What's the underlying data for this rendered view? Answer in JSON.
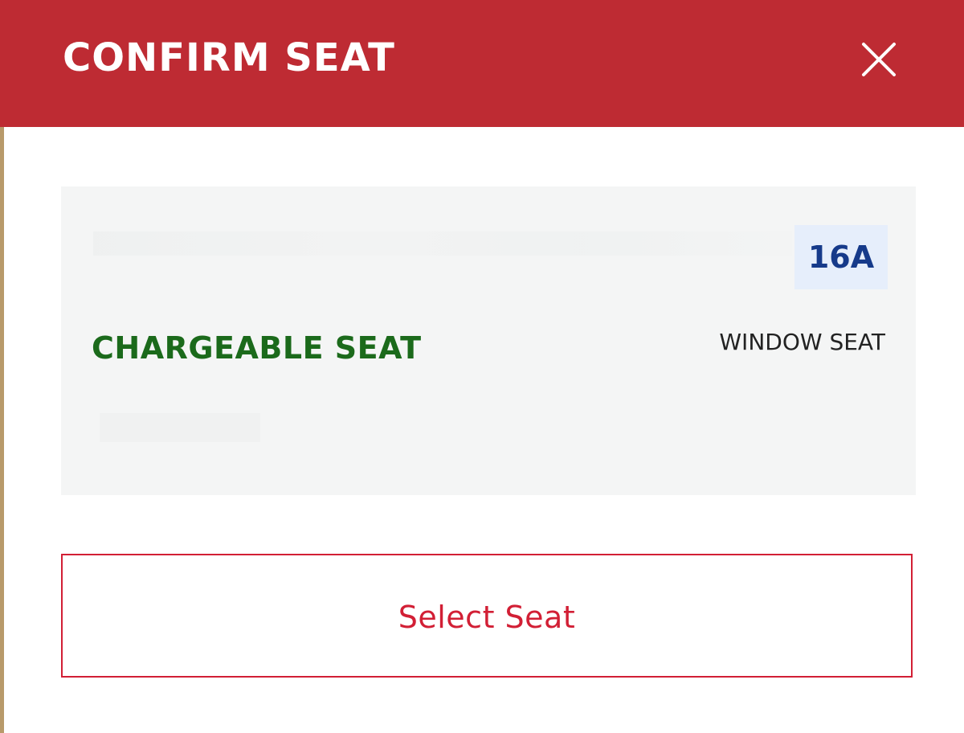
{
  "dialog": {
    "title": "CONFIRM SEAT",
    "close_icon": "close-icon"
  },
  "seat": {
    "number": "16A",
    "category": "CHARGEABLE SEAT",
    "position": "WINDOW SEAT"
  },
  "actions": {
    "select_label": "Select Seat"
  },
  "colors": {
    "header_bg": "#be2b33",
    "header_text": "#ffffff",
    "card_bg": "#f4f5f5",
    "seat_number_bg": "#e6eefb",
    "seat_number_text": "#163a8a",
    "category_text": "#1b6a1b",
    "button_accent": "#d21f35"
  }
}
